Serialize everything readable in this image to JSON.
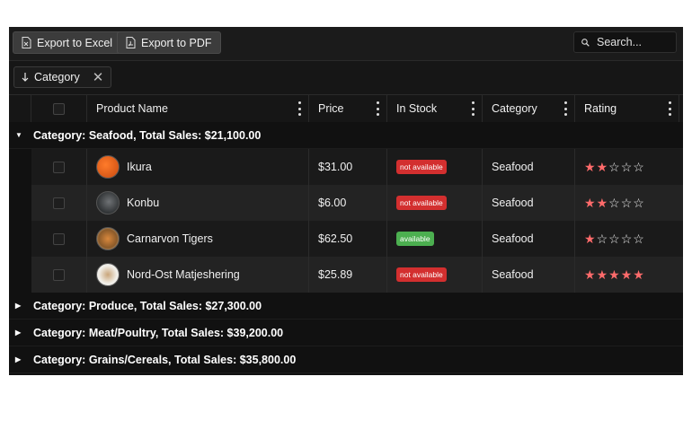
{
  "toolbar": {
    "export_excel": "Export to Excel",
    "export_pdf": "Export to PDF",
    "search_placeholder": "Search..."
  },
  "grouping": {
    "chip_label": "Category",
    "sort": "ascending"
  },
  "columns": {
    "product_name": "Product Name",
    "price": "Price",
    "in_stock": "In Stock",
    "category": "Category",
    "rating": "Rating"
  },
  "groups": [
    {
      "label": "Category: Seafood, Total Sales: $21,100.00",
      "expanded": true
    },
    {
      "label": "Category: Produce, Total Sales: $27,300.00",
      "expanded": false
    },
    {
      "label": "Category: Meat/Poultry, Total Sales: $39,200.00",
      "expanded": false
    },
    {
      "label": "Category: Grains/Cereals, Total Sales: $35,800.00",
      "expanded": false
    }
  ],
  "rows": [
    {
      "name": "Ikura",
      "price": "$31.00",
      "stock": "not available",
      "category": "Seafood",
      "rating": 2
    },
    {
      "name": "Konbu",
      "price": "$6.00",
      "stock": "not available",
      "category": "Seafood",
      "rating": 2
    },
    {
      "name": "Carnarvon Tigers",
      "price": "$62.50",
      "stock": "available",
      "category": "Seafood",
      "rating": 1
    },
    {
      "name": "Nord-Ost Matjeshering",
      "price": "$25.89",
      "stock": "not available",
      "category": "Seafood",
      "rating": 5
    }
  ],
  "icons": {
    "excel": "excel-file-icon",
    "pdf": "pdf-file-icon",
    "search": "search-icon",
    "sort": "arrow-down-icon",
    "remove": "close-icon",
    "menu": "kebab-menu-icon",
    "expand": "caret-icon"
  },
  "colors": {
    "unavailable": "#d32f2f",
    "available": "#4caf50",
    "star": "#ff6b6b"
  }
}
